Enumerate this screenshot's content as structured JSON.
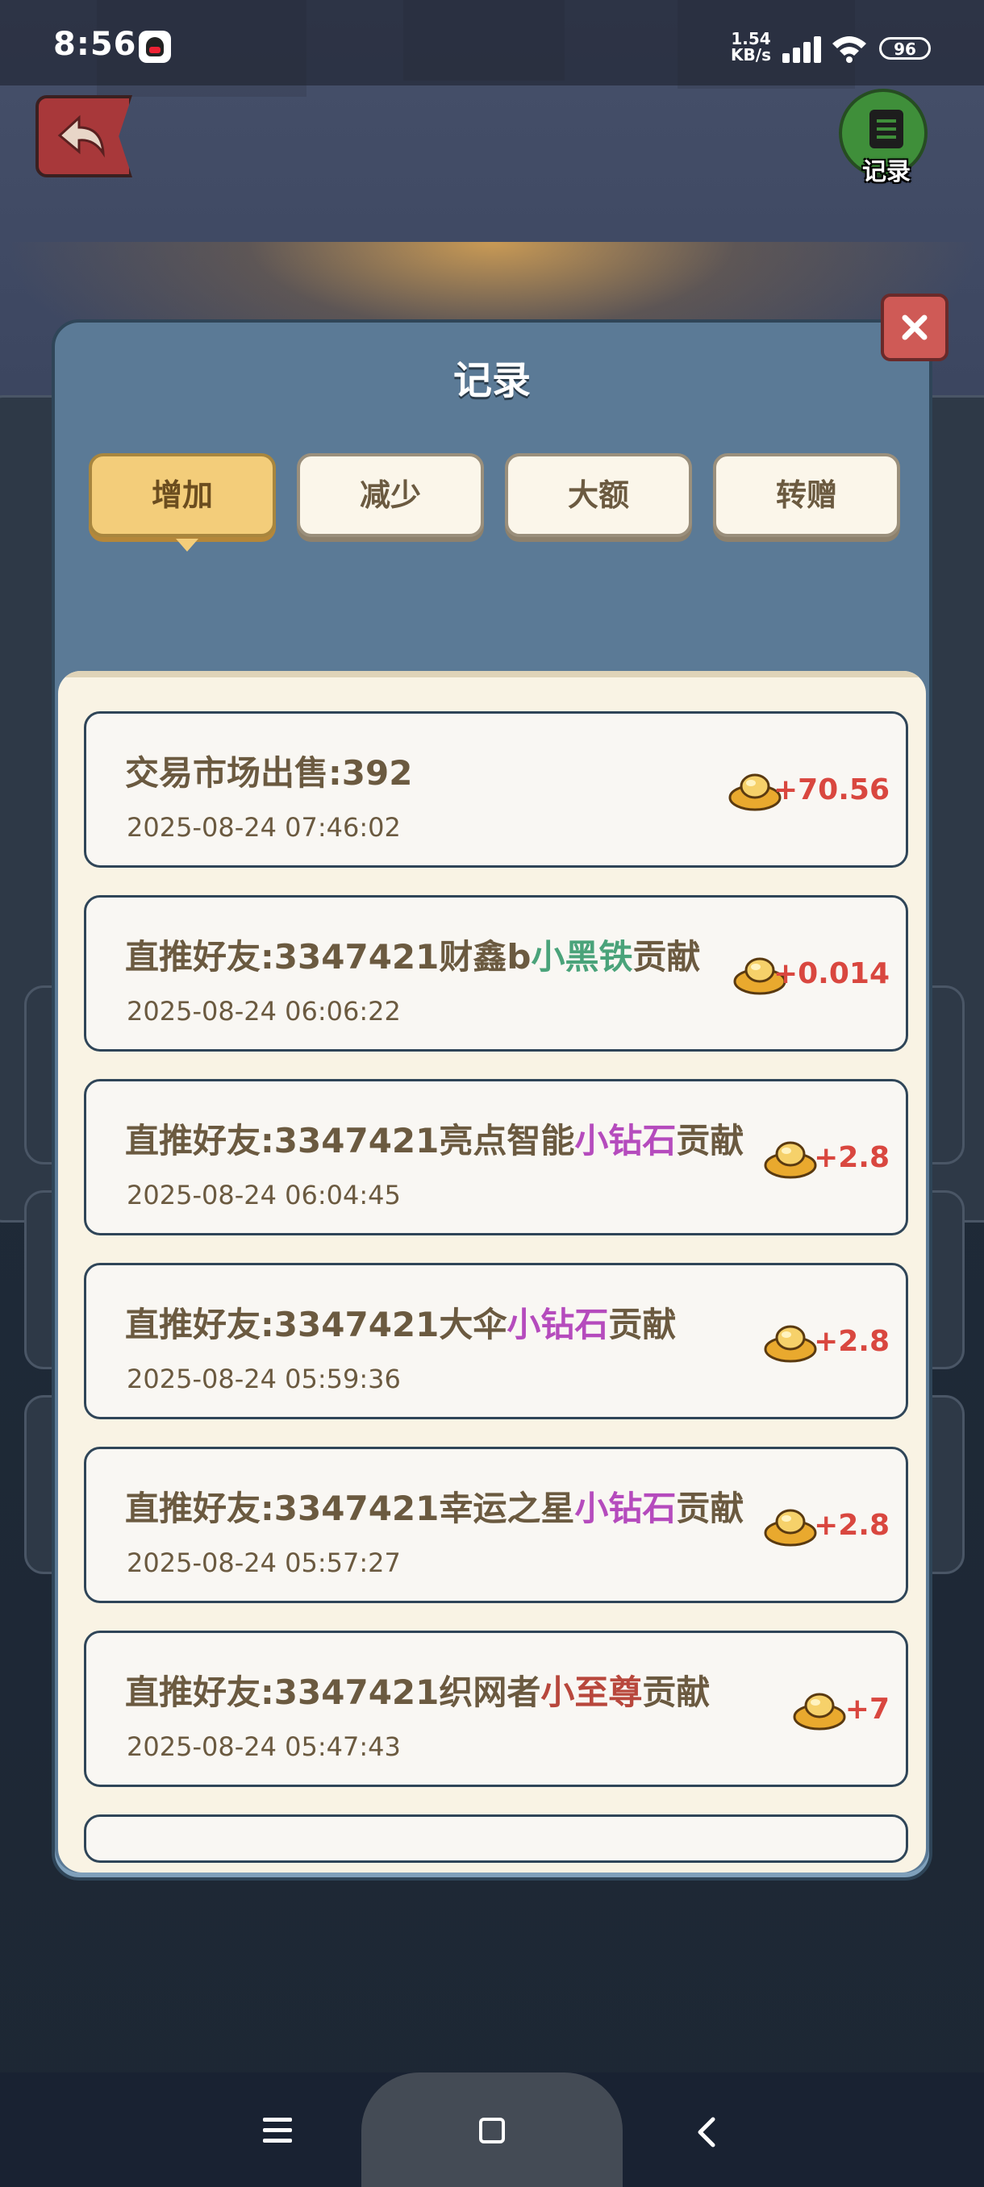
{
  "status_bar": {
    "time": "8:56",
    "net_speed_value": "1.54",
    "net_speed_unit": "KB/s",
    "battery": "96"
  },
  "header": {
    "record_label": "记录"
  },
  "dialog": {
    "title": "记录",
    "tabs": [
      {
        "label": "增加",
        "active": true
      },
      {
        "label": "减少",
        "active": false
      },
      {
        "label": "大额",
        "active": false
      },
      {
        "label": "转赠",
        "active": false
      }
    ],
    "records": [
      {
        "title": "交易市场出售:392",
        "date": "2025-08-24 07:46:02",
        "amount": "+70.56"
      },
      {
        "title_prefix": "直推好友:3347421财鑫b",
        "title_highlight": "小黑铁",
        "title_suffix": "贡献",
        "date": "2025-08-24 06:06:22",
        "amount": "+0.014"
      },
      {
        "title_prefix": "直推好友:3347421亮点智能",
        "title_highlight": "小钻石",
        "title_suffix": "贡献",
        "date": "2025-08-24 06:04:45",
        "amount": "+2.8"
      },
      {
        "title_prefix": "直推好友:3347421大伞",
        "title_highlight": "小钻石",
        "title_suffix": "贡献",
        "date": "2025-08-24 05:59:36",
        "amount": "+2.8"
      },
      {
        "title_prefix": "直推好友:3347421幸运之星",
        "title_highlight": "小钻石",
        "title_suffix": "贡献",
        "date": "2025-08-24 05:57:27",
        "amount": "+2.8"
      },
      {
        "title_prefix": "直推好友:3347421织网者",
        "title_highlight": "小至尊",
        "title_suffix": "贡献",
        "date": "2025-08-24 05:47:43",
        "amount": "+7"
      }
    ]
  },
  "colors": {
    "highlight_green": "#4aa37a",
    "highlight_purple": "#b54bbd",
    "highlight_red": "#b8473c",
    "amount_red": "#d9473f"
  },
  "icons": [
    "back-arrow-icon",
    "record-document-icon",
    "close-icon",
    "gold-ingot-icon",
    "menu-icon",
    "home-icon",
    "nav-back-icon"
  ]
}
